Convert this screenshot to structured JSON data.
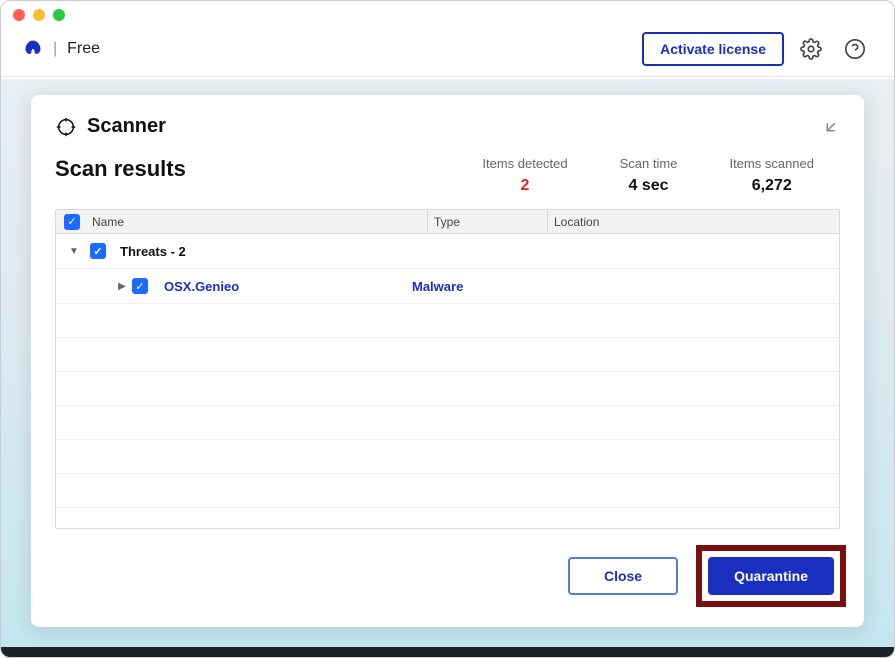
{
  "app": {
    "edition": "Free"
  },
  "topbar": {
    "activate": "Activate license"
  },
  "panel": {
    "title": "Scanner"
  },
  "results": {
    "title": "Scan results",
    "stats": {
      "detected_label": "Items detected",
      "detected_value": "2",
      "time_label": "Scan time",
      "time_value": "4 sec",
      "scanned_label": "Items scanned",
      "scanned_value": "6,272"
    }
  },
  "table": {
    "columns": {
      "name": "Name",
      "type": "Type",
      "location": "Location"
    },
    "group": {
      "label": "Threats - 2"
    },
    "rows": [
      {
        "name": "OSX.Genieo",
        "type": "Malware",
        "location": ""
      }
    ]
  },
  "footer": {
    "close": "Close",
    "quarantine": "Quarantine"
  }
}
